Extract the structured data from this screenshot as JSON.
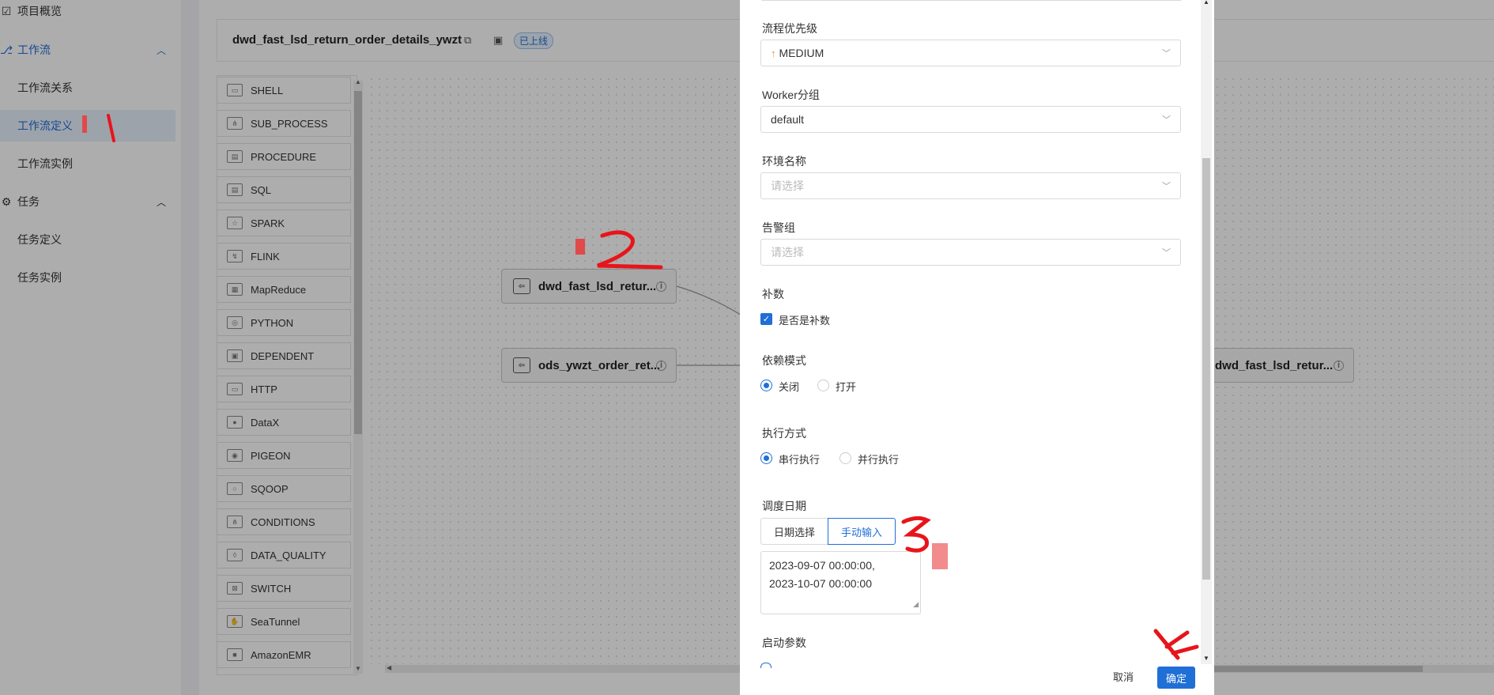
{
  "sidebar": {
    "items": [
      {
        "label": "项目概览",
        "icon": "dashboard-icon"
      },
      {
        "label": "工作流",
        "icon": "workflow-icon",
        "expanded": true
      },
      {
        "label": "工作流关系"
      },
      {
        "label": "工作流定义",
        "active": true
      },
      {
        "label": "工作流实例"
      },
      {
        "label": "任务",
        "icon": "gear-icon",
        "expanded": true
      },
      {
        "label": "任务定义"
      },
      {
        "label": "任务实例"
      }
    ]
  },
  "workflow": {
    "title": "dwd_fast_lsd_return_order_details_ywzt",
    "status_badge": "已上线"
  },
  "palette": {
    "items": [
      "SHELL",
      "SUB_PROCESS",
      "PROCEDURE",
      "SQL",
      "SPARK",
      "FLINK",
      "MapReduce",
      "PYTHON",
      "DEPENDENT",
      "HTTP",
      "DataX",
      "PIGEON",
      "SQOOP",
      "CONDITIONS",
      "DATA_QUALITY",
      "SWITCH",
      "SeaTunnel",
      "AmazonEMR"
    ]
  },
  "dag": {
    "nodes": [
      {
        "label": "dwd_fast_lsd_retur..."
      },
      {
        "label": "ods_ywzt_order_ret..."
      },
      {
        "label": "dwd_fast_lsd_retur..."
      }
    ]
  },
  "modal": {
    "priority": {
      "label": "流程优先级",
      "value": "MEDIUM",
      "color": "#f0883a"
    },
    "worker_group": {
      "label": "Worker分组",
      "value": "default"
    },
    "environment": {
      "label": "环境名称",
      "placeholder": "请选择"
    },
    "alert_group": {
      "label": "告警组",
      "placeholder": "请选择"
    },
    "complement": {
      "label": "补数",
      "checkbox_label": "是否是补数",
      "checked": true
    },
    "dependency_mode": {
      "label": "依赖模式",
      "options": [
        "关闭",
        "打开"
      ],
      "selected": "关闭"
    },
    "execution_mode": {
      "label": "执行方式",
      "options": [
        "串行执行",
        "并行执行"
      ],
      "selected": "串行执行"
    },
    "schedule_date": {
      "label": "调度日期",
      "tabs": [
        "日期选择",
        "手动输入"
      ],
      "active_tab": "手动输入",
      "value_line1": "2023-09-07 00:00:00,",
      "value_line2": "2023-10-07 00:00:00"
    },
    "startup_params": {
      "label": "启动参数"
    },
    "buttons": {
      "cancel": "取消",
      "ok": "确定"
    }
  },
  "annotations": [
    "1",
    "2",
    "3",
    "4"
  ],
  "colors": {
    "accent": "#1f6fd6",
    "annotation": "#e8141b"
  }
}
